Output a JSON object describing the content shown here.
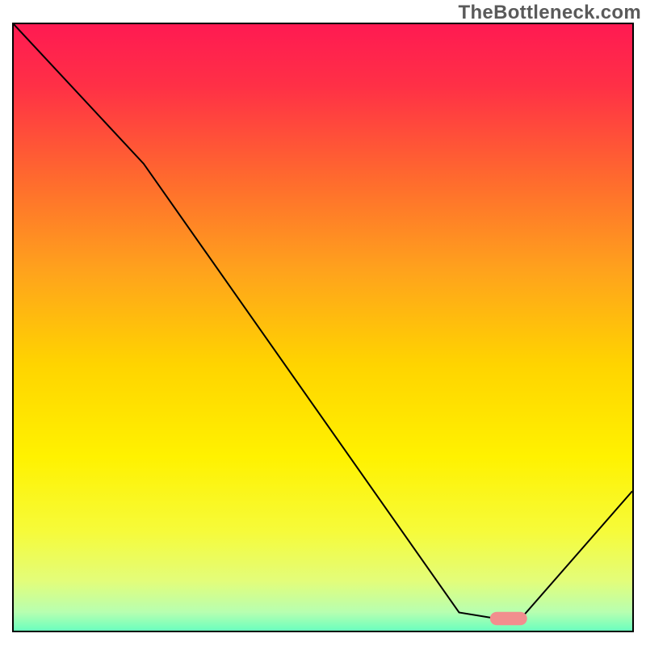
{
  "watermark": "TheBottleneck.com",
  "chart_data": {
    "type": "line",
    "title": "",
    "xlabel": "",
    "ylabel": "",
    "xlim": [
      0,
      100
    ],
    "ylim": [
      0,
      100
    ],
    "gradient_stops": [
      {
        "offset": 0.0,
        "color": "#ff1a52"
      },
      {
        "offset": 0.1,
        "color": "#ff3046"
      },
      {
        "offset": 0.25,
        "color": "#ff6a2e"
      },
      {
        "offset": 0.4,
        "color": "#ffa31c"
      },
      {
        "offset": 0.55,
        "color": "#ffd400"
      },
      {
        "offset": 0.7,
        "color": "#fff200"
      },
      {
        "offset": 0.82,
        "color": "#f6fb3a"
      },
      {
        "offset": 0.9,
        "color": "#e3fd7a"
      },
      {
        "offset": 0.95,
        "color": "#b8ffb0"
      },
      {
        "offset": 0.985,
        "color": "#5fffc0"
      },
      {
        "offset": 1.0,
        "color": "#00e67a"
      }
    ],
    "series": [
      {
        "name": "bottleneck-curve",
        "color": "#000000",
        "x": [
          0,
          21,
          72,
          78,
          82,
          100
        ],
        "y": [
          100,
          77,
          3,
          2,
          2,
          23
        ]
      }
    ],
    "marker": {
      "name": "optimal-marker",
      "x_start": 77,
      "x_end": 83,
      "y": 2,
      "color": "#f28e8e",
      "thickness": 2.2
    }
  }
}
